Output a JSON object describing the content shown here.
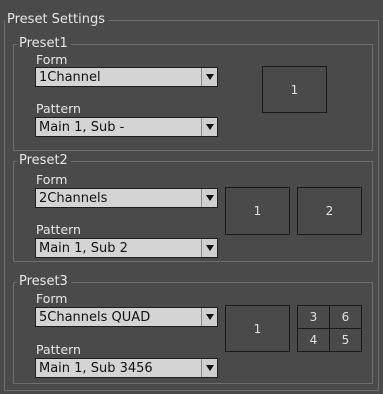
{
  "preset_settings": {
    "title": "Preset Settings",
    "presets": [
      {
        "title": "Preset1",
        "form_label": "Form",
        "form_value": "1Channel",
        "pattern_label": "Pattern",
        "pattern_value": "Main 1, Sub -",
        "screens": [
          "1"
        ]
      },
      {
        "title": "Preset2",
        "form_label": "Form",
        "form_value": "2Channels",
        "pattern_label": "Pattern",
        "pattern_value": "Main 1, Sub 2",
        "screens": [
          "1",
          "2"
        ]
      },
      {
        "title": "Preset3",
        "form_label": "Form",
        "form_value": "5Channels QUAD",
        "pattern_label": "Pattern",
        "pattern_value": "Main 1, Sub 3456",
        "screens": [
          "1",
          "3",
          "6",
          "4",
          "5"
        ]
      }
    ]
  }
}
